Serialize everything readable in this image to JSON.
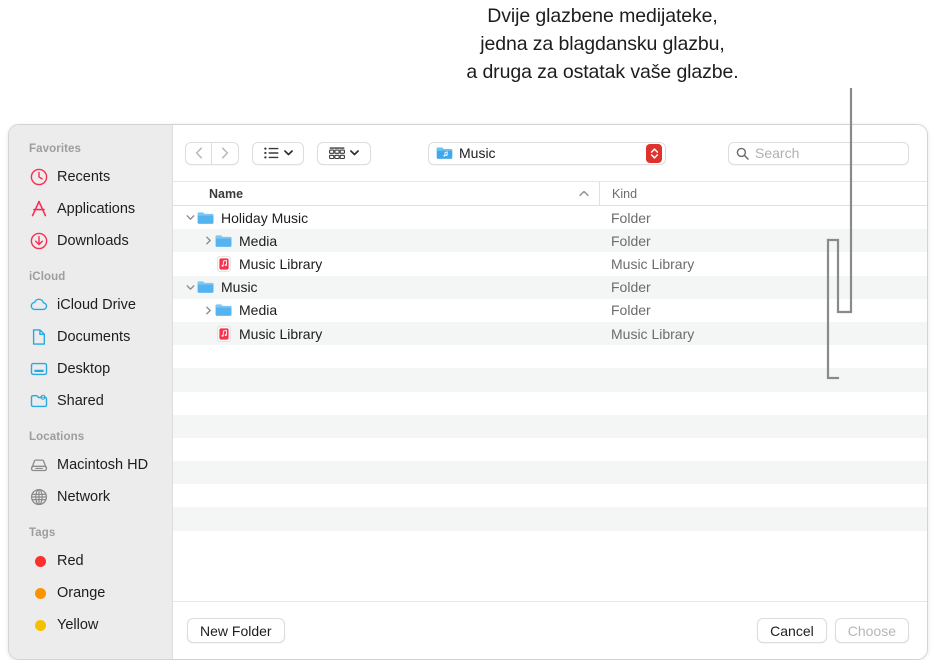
{
  "annotation": {
    "lines": [
      "Dvije glazbene medijateke,",
      "jedna za blagdansku glazbu,",
      "a druga za ostatak vaše glazbe."
    ]
  },
  "sidebar": {
    "sections": [
      {
        "title": "Favorites",
        "items": [
          {
            "label": "Recents",
            "icon": "clock-icon"
          },
          {
            "label": "Applications",
            "icon": "applications-icon"
          },
          {
            "label": "Downloads",
            "icon": "download-icon"
          }
        ]
      },
      {
        "title": "iCloud",
        "items": [
          {
            "label": "iCloud Drive",
            "icon": "cloud-icon"
          },
          {
            "label": "Documents",
            "icon": "document-icon"
          },
          {
            "label": "Desktop",
            "icon": "desktop-icon"
          },
          {
            "label": "Shared",
            "icon": "shared-folder-icon"
          }
        ]
      },
      {
        "title": "Locations",
        "items": [
          {
            "label": "Macintosh HD",
            "icon": "hard-disk-icon"
          },
          {
            "label": "Network",
            "icon": "globe-icon"
          }
        ]
      },
      {
        "title": "Tags",
        "items": [
          {
            "label": "Red",
            "icon": "tag-dot-icon",
            "color": "#F8312B"
          },
          {
            "label": "Orange",
            "icon": "tag-dot-icon",
            "color": "#F99300"
          },
          {
            "label": "Yellow",
            "icon": "tag-dot-icon",
            "color": "#F4C000"
          }
        ]
      }
    ]
  },
  "toolbar": {
    "back_icon": "chevron-left-icon",
    "forward_icon": "chevron-right-icon",
    "view_icon": "list-view-icon",
    "view_chevron_icon": "chevron-down-icon",
    "arrange_icon": "group-view-icon",
    "arrange_chevron_icon": "chevron-down-icon",
    "path_label": "Music",
    "path_icon": "music-folder-icon",
    "stepper_icon": "up-down-stepper-icon",
    "search_icon": "search-icon",
    "search_placeholder": "Search",
    "search_value": ""
  },
  "columns": {
    "name": "Name",
    "kind": "Kind",
    "sort_icon": "sort-ascending-caret-icon"
  },
  "file_list": {
    "rows": [
      {
        "name": "Holiday Music",
        "kind": "Folder",
        "indent": 0,
        "icon": "folder-icon",
        "twisty": "expanded"
      },
      {
        "name": "Media",
        "kind": "Folder",
        "indent": 1,
        "icon": "folder-icon",
        "twisty": "collapsed"
      },
      {
        "name": "Music Library",
        "kind": "Music Library",
        "indent": 1,
        "icon": "music-library-icon",
        "twisty": "none"
      },
      {
        "name": "Music",
        "kind": "Folder",
        "indent": 0,
        "icon": "folder-icon",
        "twisty": "expanded"
      },
      {
        "name": "Media",
        "kind": "Folder",
        "indent": 1,
        "icon": "folder-icon",
        "twisty": "collapsed"
      },
      {
        "name": "Music Library",
        "kind": "Music Library",
        "indent": 1,
        "icon": "music-library-icon",
        "twisty": "none"
      }
    ],
    "empty_row_count": 9
  },
  "bottom": {
    "new_folder_label": "New Folder",
    "cancel_label": "Cancel",
    "choose_label": "Choose"
  }
}
